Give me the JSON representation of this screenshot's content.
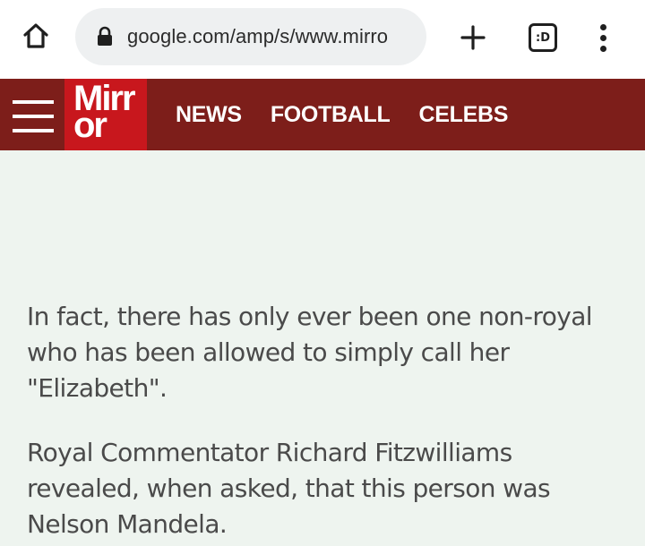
{
  "browser": {
    "url": "google.com/amp/s/www.mirro",
    "tabs_label": ":D",
    "icons": {
      "home": "home-icon",
      "lock": "lock-icon",
      "new_tab": "plus-icon",
      "tabs": "tab-switcher-icon",
      "menu": "more-vert-icon"
    }
  },
  "site": {
    "logo_line1": "Mirr",
    "logo_line2": "or",
    "nav": [
      "NEWS",
      "FOOTBALL",
      "CELEBS"
    ],
    "colors": {
      "header": "#7d1e1a",
      "logo": "#c8171d",
      "page_bg": "#eef4ef"
    }
  },
  "article": {
    "paragraphs": [
      "In fact, there has only ever been one non-royal who has been allowed to simply call her \"Elizabeth\".",
      "Royal Commentator Richard Fitzwilliams revealed, when asked, that this person was Nelson Mandela."
    ]
  }
}
